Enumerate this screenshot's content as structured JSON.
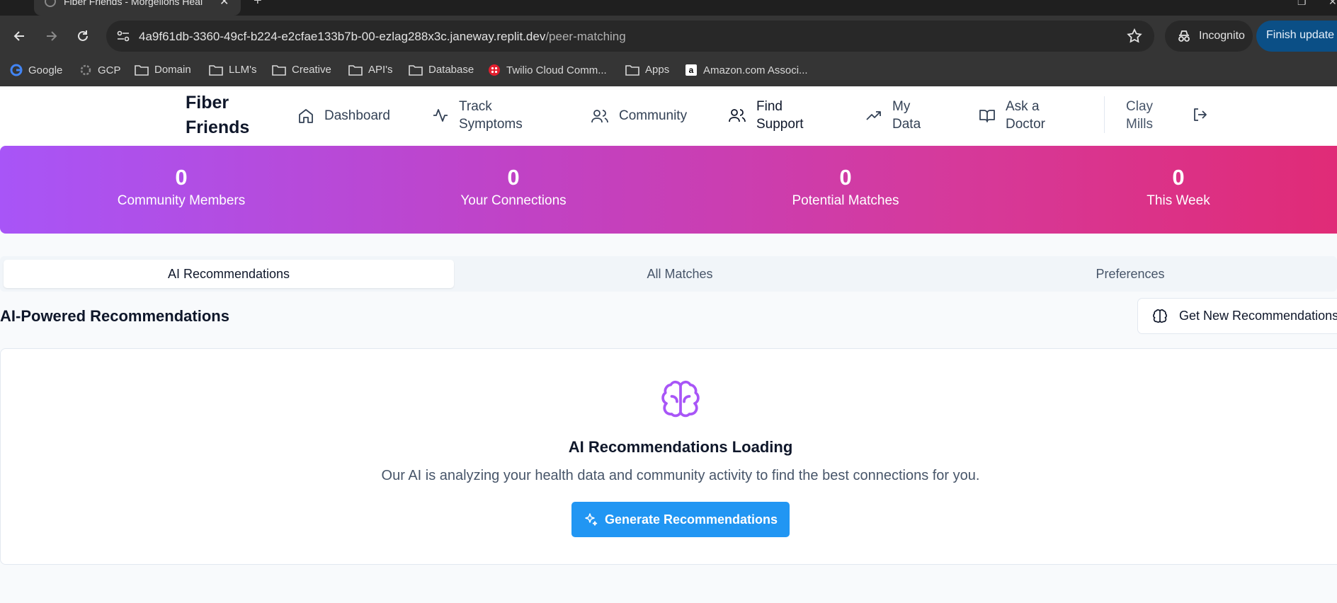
{
  "browser": {
    "tab_title": "Fiber Friends - Morgellons Heal",
    "url_host": "4a9f61db-3360-49cf-b224-e2cfae133b7b-00-ezlag288x3c.janeway.replit.dev",
    "url_path": "/peer-matching",
    "incognito_label": "Incognito",
    "finish_update_label": "Finish update",
    "bookmarks": [
      "Google",
      "GCP",
      "Domain",
      "LLM's",
      "Creative",
      "API's",
      "Database",
      "Twilio Cloud Comm...",
      "Apps",
      "Amazon.com Associ..."
    ]
  },
  "app": {
    "logo_line1": "Fiber",
    "logo_line2": "Friends",
    "nav": [
      {
        "line1": "Dashboard",
        "line2": ""
      },
      {
        "line1": "Track",
        "line2": "Symptoms"
      },
      {
        "line1": "Community",
        "line2": ""
      },
      {
        "line1": "Find",
        "line2": "Support"
      },
      {
        "line1": "My",
        "line2": "Data"
      },
      {
        "line1": "Ask a",
        "line2": "Doctor"
      }
    ],
    "user_line1": "Clay",
    "user_line2": "Mills"
  },
  "stats": [
    {
      "value": "0",
      "label": "Community Members"
    },
    {
      "value": "0",
      "label": "Your Connections"
    },
    {
      "value": "0",
      "label": "Potential Matches"
    },
    {
      "value": "0",
      "label": "This Week"
    }
  ],
  "tabs": [
    "AI Recommendations",
    "All Matches",
    "Preferences"
  ],
  "section": {
    "title": "AI-Powered Recommendations",
    "get_new_label": "Get New Recommendations"
  },
  "card": {
    "title": "AI Recommendations Loading",
    "description": "Our AI is analyzing your health data and community activity to find the best connections for you.",
    "button_label": "Generate Recommendations"
  },
  "colors": {
    "gradient_start": "#a855f7",
    "gradient_end": "#e02b77",
    "primary_button": "#2196f3",
    "brain_icon": "#a855f7"
  }
}
